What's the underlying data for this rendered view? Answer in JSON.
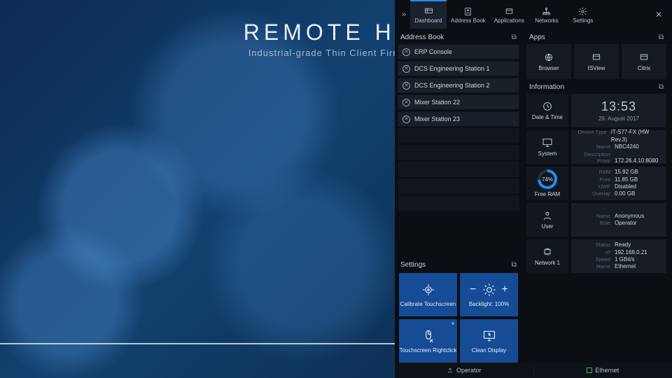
{
  "desktop": {
    "title": "REMOTE HMI",
    "subtitle": "Industrial-grade Thin Client Firmware"
  },
  "nav": {
    "items": [
      {
        "label": "Dashboard",
        "active": true
      },
      {
        "label": "Address Book"
      },
      {
        "label": "Applications"
      },
      {
        "label": "Networks"
      },
      {
        "label": "Settings"
      }
    ]
  },
  "addressBook": {
    "title": "Address Book",
    "items": [
      "ERP Console",
      "DCS Engineering Station 1",
      "DCS Engineering Station 2",
      "Mixer Station 22",
      "Mixer Station 23"
    ]
  },
  "settings": {
    "title": "Settings",
    "calibrate": "Calibrate Touchscreen",
    "backlight": "Backlight: 100%",
    "rightclick": "Touchscreen Rightclick",
    "clean": "Clean Display"
  },
  "apps": {
    "title": "Apps",
    "items": [
      "Browser",
      "ISView",
      "Citrix"
    ]
  },
  "information": {
    "title": "Information",
    "datetime": {
      "label": "Date & Time",
      "time": "13:53",
      "date": "29. August 2017"
    },
    "system": {
      "label": "System",
      "deviceTypeK": "Device Type",
      "deviceType": "IT-S77-FX (HW Rev.3)",
      "nameK": "Name",
      "name": "NBC4240",
      "descriptionK": "Description",
      "description": "",
      "proxyK": "Proxy",
      "proxy": "172.26.4.10:8080"
    },
    "ram": {
      "label": "Free RAM",
      "pct": "74%",
      "ramK": "RAM",
      "ram": "15.92 GB",
      "freeK": "Free",
      "free": "11.85 GB",
      "uwfK": "UWF",
      "uwf": "Disabled",
      "overlayK": "Overlay",
      "overlay": "0.00 GB"
    },
    "user": {
      "label": "User",
      "nameK": "Name",
      "name": "Anonymous",
      "roleK": "Role",
      "role": "Operator"
    },
    "network": {
      "label": "Network 1",
      "statusK": "Status",
      "status": "Ready",
      "ipK": "IP",
      "ip": "192.168.0.21",
      "speedK": "Speed",
      "speed": "1 GBit/s",
      "nameK": "Name",
      "name": "Ethernet"
    }
  },
  "bottom": {
    "operator": "Operator",
    "ethernet": "Ethernet"
  }
}
